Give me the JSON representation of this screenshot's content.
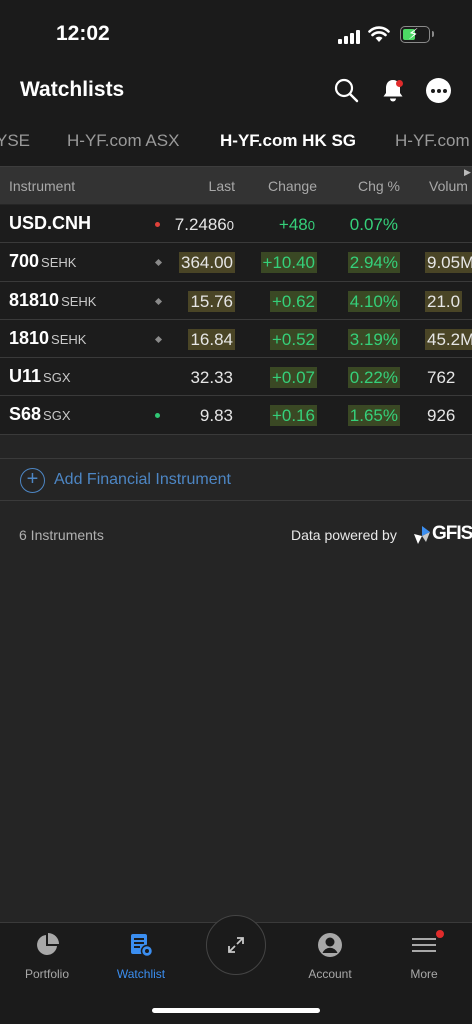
{
  "status_bar": {
    "time": "12:02"
  },
  "header": {
    "title": "Watchlists"
  },
  "tabs": [
    {
      "label": "YSE",
      "active": false
    },
    {
      "label": "H-YF.com ASX",
      "active": false
    },
    {
      "label": "H-YF.com HK SG",
      "active": true
    },
    {
      "label": "H-YF.com",
      "active": false
    }
  ],
  "columns": [
    "Instrument",
    "Last",
    "Change",
    "Chg %",
    "Volum"
  ],
  "rows": [
    {
      "symbol": "USD.CNH",
      "exchange": "",
      "marker": "red-dot",
      "last_main": "7.2486",
      "last_small": "0",
      "change_main": "+48",
      "change_small": "0",
      "chg_pct": "0.07%",
      "volume": ""
    },
    {
      "symbol": "700",
      "exchange": "SEHK",
      "marker": "diamond",
      "last": "364.00",
      "change": "+10.40",
      "chg_pct": "2.94%",
      "volume": "9.05M"
    },
    {
      "symbol": "81810",
      "exchange": "SEHK",
      "marker": "diamond",
      "last": "15.76",
      "change": "+0.62",
      "chg_pct": "4.10%",
      "volume": "21.0"
    },
    {
      "symbol": "1810",
      "exchange": "SEHK",
      "marker": "diamond",
      "last": "16.84",
      "change": "+0.52",
      "chg_pct": "3.19%",
      "volume": "45.2M"
    },
    {
      "symbol": "U11",
      "exchange": "SGX",
      "marker": "",
      "last": "32.33",
      "change": "+0.07",
      "chg_pct": "0.22%",
      "volume": "762"
    },
    {
      "symbol": "S68",
      "exchange": "SGX",
      "marker": "green-dot",
      "last": "9.83",
      "change": "+0.16",
      "chg_pct": "1.65%",
      "volume": "926"
    }
  ],
  "add_instrument": {
    "label": "Add Financial Instrument"
  },
  "footer": {
    "count": "6 Instruments",
    "powered_by": "Data powered by",
    "brand": "GFIS"
  },
  "bottom_nav": [
    {
      "label": "Portfolio",
      "icon": "pie-chart-icon",
      "active": false
    },
    {
      "label": "Watchlist",
      "icon": "watchlist-icon",
      "active": true
    },
    {
      "label": "",
      "icon": "expand-arrows-icon",
      "active": false
    },
    {
      "label": "Account",
      "icon": "user-icon",
      "active": false
    },
    {
      "label": "More",
      "icon": "hamburger-icon",
      "active": false
    }
  ],
  "colors": {
    "accent": "#3b8ef0",
    "positive": "#35d07a",
    "alert": "#e02b2b",
    "link": "#4d86c4"
  }
}
